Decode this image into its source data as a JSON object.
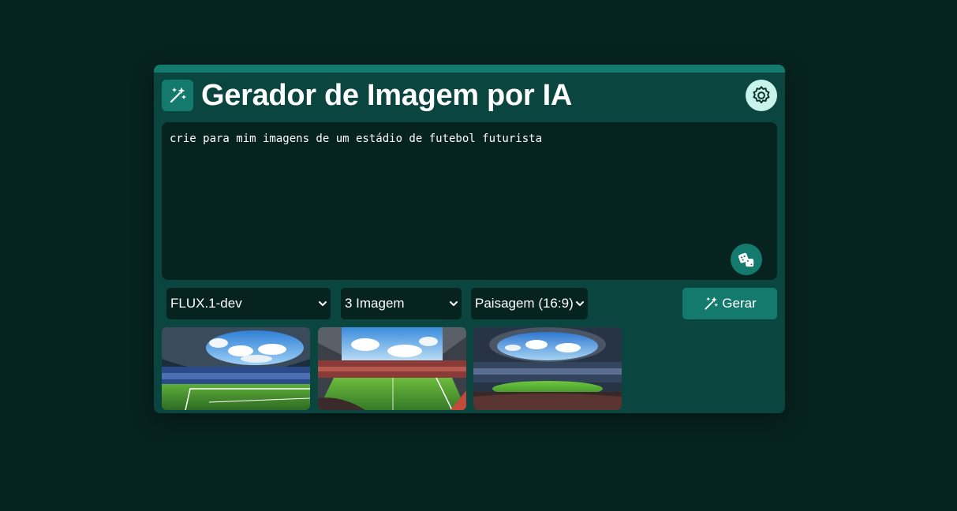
{
  "header": {
    "title": "Gerador de Imagem por IA",
    "logo_icon": "magic-wand-icon",
    "settings_icon": "gear-icon"
  },
  "prompt": {
    "value": "crie para mim imagens de um estádio de futebol futurista",
    "random_icon": "dice-icon"
  },
  "controls": {
    "model": "FLUX.1-dev",
    "count": "3 Imagem",
    "aspect": "Paisagem (16:9)",
    "generate_label": "Gerar",
    "generate_icon": "magic-wand-icon"
  },
  "results": {
    "images": [
      {
        "subject": "stadium-image"
      },
      {
        "subject": "stadium-image"
      },
      {
        "subject": "stadium-image"
      }
    ]
  },
  "colors": {
    "page_bg": "#072320",
    "card_bg": "#0b4540",
    "accent": "#137a6d",
    "settings_bg": "#c7f3ec"
  }
}
